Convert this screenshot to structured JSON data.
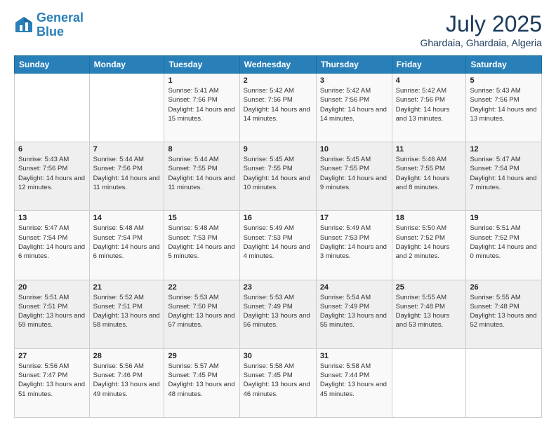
{
  "header": {
    "logo_line1": "General",
    "logo_line2": "Blue",
    "month_year": "July 2025",
    "location": "Ghardaia, Ghardaia, Algeria"
  },
  "weekdays": [
    "Sunday",
    "Monday",
    "Tuesday",
    "Wednesday",
    "Thursday",
    "Friday",
    "Saturday"
  ],
  "weeks": [
    [
      {
        "day": "",
        "sunrise": "",
        "sunset": "",
        "daylight": ""
      },
      {
        "day": "",
        "sunrise": "",
        "sunset": "",
        "daylight": ""
      },
      {
        "day": "1",
        "sunrise": "Sunrise: 5:41 AM",
        "sunset": "Sunset: 7:56 PM",
        "daylight": "Daylight: 14 hours and 15 minutes."
      },
      {
        "day": "2",
        "sunrise": "Sunrise: 5:42 AM",
        "sunset": "Sunset: 7:56 PM",
        "daylight": "Daylight: 14 hours and 14 minutes."
      },
      {
        "day": "3",
        "sunrise": "Sunrise: 5:42 AM",
        "sunset": "Sunset: 7:56 PM",
        "daylight": "Daylight: 14 hours and 14 minutes."
      },
      {
        "day": "4",
        "sunrise": "Sunrise: 5:42 AM",
        "sunset": "Sunset: 7:56 PM",
        "daylight": "Daylight: 14 hours and 13 minutes."
      },
      {
        "day": "5",
        "sunrise": "Sunrise: 5:43 AM",
        "sunset": "Sunset: 7:56 PM",
        "daylight": "Daylight: 14 hours and 13 minutes."
      }
    ],
    [
      {
        "day": "6",
        "sunrise": "Sunrise: 5:43 AM",
        "sunset": "Sunset: 7:56 PM",
        "daylight": "Daylight: 14 hours and 12 minutes."
      },
      {
        "day": "7",
        "sunrise": "Sunrise: 5:44 AM",
        "sunset": "Sunset: 7:56 PM",
        "daylight": "Daylight: 14 hours and 11 minutes."
      },
      {
        "day": "8",
        "sunrise": "Sunrise: 5:44 AM",
        "sunset": "Sunset: 7:55 PM",
        "daylight": "Daylight: 14 hours and 11 minutes."
      },
      {
        "day": "9",
        "sunrise": "Sunrise: 5:45 AM",
        "sunset": "Sunset: 7:55 PM",
        "daylight": "Daylight: 14 hours and 10 minutes."
      },
      {
        "day": "10",
        "sunrise": "Sunrise: 5:45 AM",
        "sunset": "Sunset: 7:55 PM",
        "daylight": "Daylight: 14 hours and 9 minutes."
      },
      {
        "day": "11",
        "sunrise": "Sunrise: 5:46 AM",
        "sunset": "Sunset: 7:55 PM",
        "daylight": "Daylight: 14 hours and 8 minutes."
      },
      {
        "day": "12",
        "sunrise": "Sunrise: 5:47 AM",
        "sunset": "Sunset: 7:54 PM",
        "daylight": "Daylight: 14 hours and 7 minutes."
      }
    ],
    [
      {
        "day": "13",
        "sunrise": "Sunrise: 5:47 AM",
        "sunset": "Sunset: 7:54 PM",
        "daylight": "Daylight: 14 hours and 6 minutes."
      },
      {
        "day": "14",
        "sunrise": "Sunrise: 5:48 AM",
        "sunset": "Sunset: 7:54 PM",
        "daylight": "Daylight: 14 hours and 6 minutes."
      },
      {
        "day": "15",
        "sunrise": "Sunrise: 5:48 AM",
        "sunset": "Sunset: 7:53 PM",
        "daylight": "Daylight: 14 hours and 5 minutes."
      },
      {
        "day": "16",
        "sunrise": "Sunrise: 5:49 AM",
        "sunset": "Sunset: 7:53 PM",
        "daylight": "Daylight: 14 hours and 4 minutes."
      },
      {
        "day": "17",
        "sunrise": "Sunrise: 5:49 AM",
        "sunset": "Sunset: 7:53 PM",
        "daylight": "Daylight: 14 hours and 3 minutes."
      },
      {
        "day": "18",
        "sunrise": "Sunrise: 5:50 AM",
        "sunset": "Sunset: 7:52 PM",
        "daylight": "Daylight: 14 hours and 2 minutes."
      },
      {
        "day": "19",
        "sunrise": "Sunrise: 5:51 AM",
        "sunset": "Sunset: 7:52 PM",
        "daylight": "Daylight: 14 hours and 0 minutes."
      }
    ],
    [
      {
        "day": "20",
        "sunrise": "Sunrise: 5:51 AM",
        "sunset": "Sunset: 7:51 PM",
        "daylight": "Daylight: 13 hours and 59 minutes."
      },
      {
        "day": "21",
        "sunrise": "Sunrise: 5:52 AM",
        "sunset": "Sunset: 7:51 PM",
        "daylight": "Daylight: 13 hours and 58 minutes."
      },
      {
        "day": "22",
        "sunrise": "Sunrise: 5:53 AM",
        "sunset": "Sunset: 7:50 PM",
        "daylight": "Daylight: 13 hours and 57 minutes."
      },
      {
        "day": "23",
        "sunrise": "Sunrise: 5:53 AM",
        "sunset": "Sunset: 7:49 PM",
        "daylight": "Daylight: 13 hours and 56 minutes."
      },
      {
        "day": "24",
        "sunrise": "Sunrise: 5:54 AM",
        "sunset": "Sunset: 7:49 PM",
        "daylight": "Daylight: 13 hours and 55 minutes."
      },
      {
        "day": "25",
        "sunrise": "Sunrise: 5:55 AM",
        "sunset": "Sunset: 7:48 PM",
        "daylight": "Daylight: 13 hours and 53 minutes."
      },
      {
        "day": "26",
        "sunrise": "Sunrise: 5:55 AM",
        "sunset": "Sunset: 7:48 PM",
        "daylight": "Daylight: 13 hours and 52 minutes."
      }
    ],
    [
      {
        "day": "27",
        "sunrise": "Sunrise: 5:56 AM",
        "sunset": "Sunset: 7:47 PM",
        "daylight": "Daylight: 13 hours and 51 minutes."
      },
      {
        "day": "28",
        "sunrise": "Sunrise: 5:56 AM",
        "sunset": "Sunset: 7:46 PM",
        "daylight": "Daylight: 13 hours and 49 minutes."
      },
      {
        "day": "29",
        "sunrise": "Sunrise: 5:57 AM",
        "sunset": "Sunset: 7:45 PM",
        "daylight": "Daylight: 13 hours and 48 minutes."
      },
      {
        "day": "30",
        "sunrise": "Sunrise: 5:58 AM",
        "sunset": "Sunset: 7:45 PM",
        "daylight": "Daylight: 13 hours and 46 minutes."
      },
      {
        "day": "31",
        "sunrise": "Sunrise: 5:58 AM",
        "sunset": "Sunset: 7:44 PM",
        "daylight": "Daylight: 13 hours and 45 minutes."
      },
      {
        "day": "",
        "sunrise": "",
        "sunset": "",
        "daylight": ""
      },
      {
        "day": "",
        "sunrise": "",
        "sunset": "",
        "daylight": ""
      }
    ]
  ]
}
